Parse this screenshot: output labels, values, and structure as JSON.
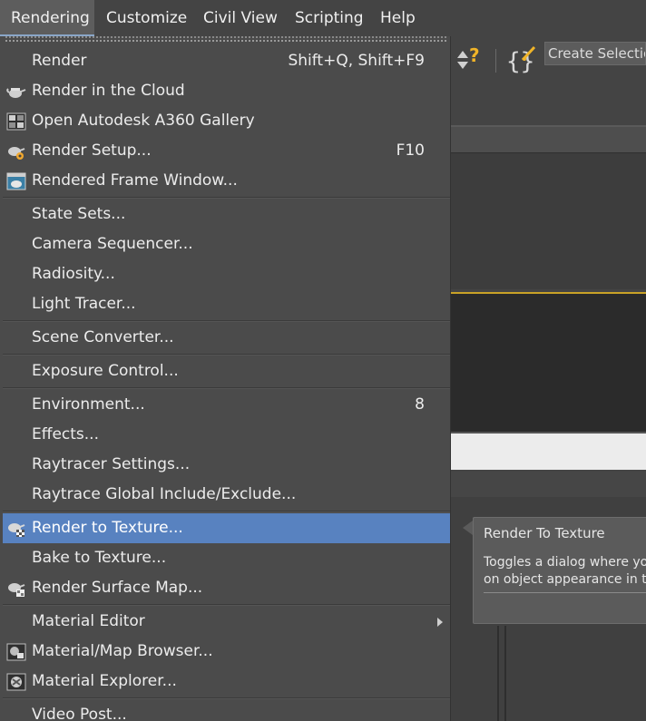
{
  "menubar": {
    "items": [
      {
        "label": "Rendering",
        "active": true
      },
      {
        "label": "Customize"
      },
      {
        "label": "Civil View"
      },
      {
        "label": "Scripting"
      },
      {
        "label": "Help"
      }
    ]
  },
  "toolbar": {
    "create_selection": "Create Selection"
  },
  "menu": {
    "items": [
      {
        "label": "Render",
        "shortcut": "Shift+Q, Shift+F9",
        "icon": "none"
      },
      {
        "label": "Render in the Cloud",
        "icon": "cloud-teapot-icon"
      },
      {
        "label": "Open Autodesk A360 Gallery",
        "icon": "gallery-grid-icon"
      },
      {
        "label": "Render Setup...",
        "shortcut": "F10",
        "icon": "render-setup-teapot-icon"
      },
      {
        "label": "Rendered Frame Window...",
        "icon": "frame-window-icon"
      },
      {
        "label": "State Sets..."
      },
      {
        "label": "Camera Sequencer..."
      },
      {
        "label": "Radiosity..."
      },
      {
        "label": "Light Tracer..."
      },
      {
        "label": "Scene Converter..."
      },
      {
        "label": "Exposure Control..."
      },
      {
        "label": "Environment...",
        "shortcut": "8"
      },
      {
        "label": "Effects..."
      },
      {
        "label": "Raytracer Settings..."
      },
      {
        "label": "Raytrace Global Include/Exclude..."
      },
      {
        "label": "Render to Texture...",
        "icon": "render-to-texture-icon",
        "highlighted": true
      },
      {
        "label": "Bake to Texture..."
      },
      {
        "label": "Render Surface Map...",
        "icon": "surface-map-icon"
      },
      {
        "label": "Material Editor",
        "submenu": true
      },
      {
        "label": "Material/Map Browser...",
        "icon": "material-browser-icon"
      },
      {
        "label": "Material Explorer...",
        "icon": "material-explorer-icon"
      },
      {
        "label": "Video Post..."
      }
    ]
  },
  "tooltip": {
    "title": "Render To Texture",
    "line1": "Toggles a dialog where yo",
    "line2": "on object appearance in t"
  },
  "colors": {
    "menu_bg": "#4b4b4b",
    "highlight": "#5882c0",
    "viewport_border": "#c9a227"
  }
}
